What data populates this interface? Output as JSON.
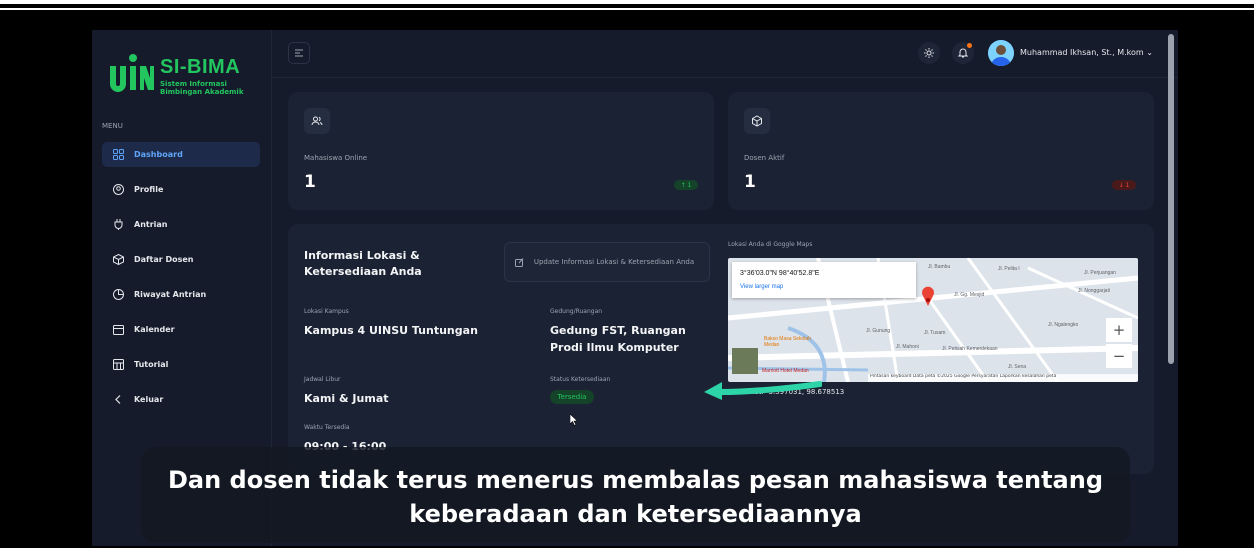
{
  "app": {
    "logo_title": "SI-BIMA",
    "logo_subtitle": "Sistem Informasi Bimbingan Akademik"
  },
  "sidebar": {
    "menu_label": "MENU",
    "items": [
      {
        "label": "Dashboard",
        "icon": "grid-icon",
        "active": true
      },
      {
        "label": "Profile",
        "icon": "user-circle-icon",
        "active": false
      },
      {
        "label": "Antrian",
        "icon": "plug-icon",
        "active": false
      },
      {
        "label": "Daftar Dosen",
        "icon": "box-icon",
        "active": false
      },
      {
        "label": "Riwayat Antrian",
        "icon": "pie-icon",
        "active": false
      },
      {
        "label": "Kalender",
        "icon": "calendar-icon",
        "active": false
      },
      {
        "label": "Tutorial",
        "icon": "table-icon",
        "active": false
      },
      {
        "label": "Keluar",
        "icon": "chevron-left-icon",
        "active": false
      }
    ]
  },
  "header": {
    "user_name": "Muhammad Ikhsan, St., M.kom"
  },
  "stats": {
    "mahasiswa": {
      "label": "Mahasiswa Online",
      "value": "1",
      "badge": "↑ 1"
    },
    "dosen": {
      "label": "Dosen Aktif",
      "value": "1",
      "badge": "↓ 1"
    }
  },
  "info": {
    "title": "Informasi Lokasi & Ketersediaan Anda",
    "update_button": "Update Informasi Lokasi & Ketersediaan Anda",
    "lokasi_label": "Lokasi Kampus",
    "lokasi_value": "Kampus 4 UINSU Tuntungan",
    "gedung_label": "Gedung/Ruangan",
    "gedung_value": "Gedung FST, Ruangan Prodi Ilmu Komputer",
    "jadwal_label": "Jadwal Libur",
    "jadwal_value": "Kami & Jumat",
    "status_label": "Status Ketersediaan",
    "status_value": "Tersedia",
    "waktu_label": "Waktu Tersedia",
    "waktu_value": "09:00 - 16:00"
  },
  "map": {
    "label": "Lokasi Anda di Goggle Maps",
    "popup_coords": "3°36'03.0\"N 98°40'52.8\"E",
    "popup_link": "View larger map",
    "footer": "Pintasan keyboard   Data peta ©2025 Google   Persyaratan   Laporkan kesalahan peta",
    "streets": [
      "Jl. Bambu",
      "Jl. Pelita I",
      "Jl. Perjuangan",
      "Jl. Nonggarjati",
      "Jl. Gg. Mesjid",
      "Jl. Ngalengko",
      "Jl. Tusam",
      "Jl. Mahoni",
      "Jl. Petisah Kemerdekaan",
      "Bakso Masa Sekolah Medan",
      "Marriott Hotel Medan",
      "Jl. Gunung",
      "Jl. Sena"
    ],
    "coordinates": "Koordinat: -3.597031, 98.678513"
  },
  "caption": {
    "line1": "Dan dosen tidak terus menerus membalas pesan mahasiswa tentang",
    "line2": "keberadaan dan ketersediaannya"
  },
  "colors": {
    "accent": "#22c55e",
    "active_blue": "#60a5fa",
    "arrow": "#2dd4a8"
  }
}
